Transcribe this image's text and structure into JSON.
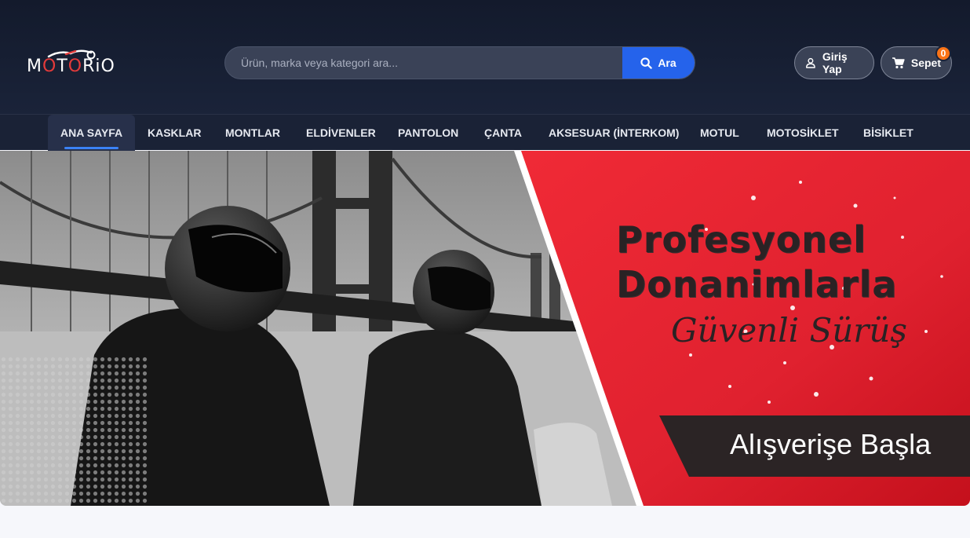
{
  "header": {
    "logo_text_start": "M",
    "logo_text_o1": "O",
    "logo_text_mid": "T",
    "logo_text_o2": "O",
    "logo_text_end": "RiO",
    "search_placeholder": "Ürün, marka veya kategori ara...",
    "search_button": "Ara",
    "login_label": "Giriş Yap",
    "cart_label": "Sepet",
    "cart_count": "0"
  },
  "nav": {
    "items": [
      "ANA SAYFA",
      "KASKLAR",
      "MONTLAR",
      "ELDİVENLER",
      "PANTOLON",
      "ÇANTA",
      "AKSESUAR (İNTERKOM)",
      "MOTUL",
      "MOTOSİKLET",
      "BİSİKLET"
    ],
    "active_index": 0
  },
  "banner": {
    "line1": "Profesyonel",
    "line2": "Donanimlarla",
    "line3": "Güvenli Sürüş",
    "cta": "Alışverişe Başla"
  },
  "colors": {
    "header_bg": "#131a2c",
    "nav_bg": "#1a2236",
    "accent_blue": "#2563eb",
    "badge_orange": "#f97316",
    "banner_red": "#e0212f",
    "logo_red": "#e23a3a"
  },
  "icons": {
    "search": "search-icon",
    "user": "user-icon",
    "cart": "cart-icon",
    "logo_mark": "motorcycle-icon"
  }
}
